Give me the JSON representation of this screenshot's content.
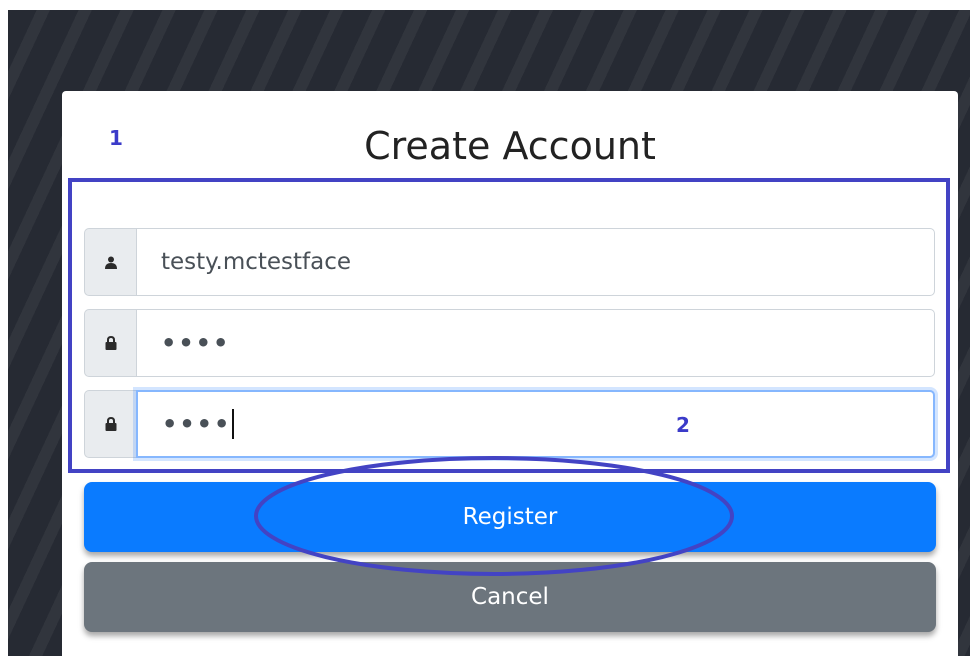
{
  "form": {
    "title": "Create Account",
    "username_value": "testy.mctestface",
    "password_value": "••••",
    "confirm_value": "••••"
  },
  "buttons": {
    "register_label": "Register",
    "cancel_label": "Cancel"
  },
  "annotations": {
    "label_1": "1",
    "label_2": "2"
  },
  "icons": {
    "username": "user-icon",
    "password": "lock-icon",
    "confirm": "lock-icon"
  },
  "colors": {
    "primary": "#0a7bff",
    "secondary": "#6c757d",
    "annotation": "#4343c4",
    "focus": "#86b7fe"
  }
}
